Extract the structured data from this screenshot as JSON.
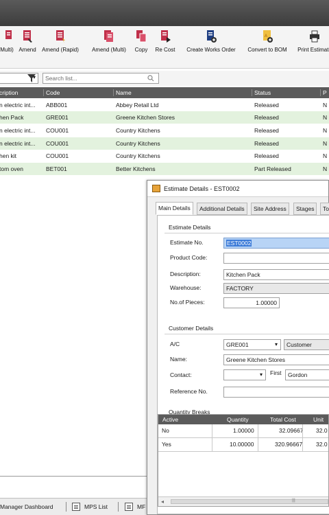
{
  "ribbon": {
    "items": [
      {
        "label": "Multi)",
        "icon": "amend-multi-icon"
      },
      {
        "label": "Amend",
        "icon": "amend-icon"
      },
      {
        "label": "Amend (Rapid)",
        "icon": "amend-rapid-icon"
      },
      {
        "label": "Amend (Multi)",
        "icon": "amend-multi-icon"
      },
      {
        "label": "Copy",
        "icon": "copy-icon"
      },
      {
        "label": "Re Cost",
        "icon": "recost-icon"
      },
      {
        "label": "Create Works Order",
        "icon": "create-works-order-icon"
      },
      {
        "label": "Convert to BOM",
        "icon": "convert-to-bom-icon"
      },
      {
        "label": "Print Estimate",
        "icon": "print-icon"
      }
    ],
    "icon_color": "#c0304a"
  },
  "filter": {
    "search_placeholder": "Search list..."
  },
  "grid": {
    "columns": [
      "cription",
      "Code",
      "Name",
      "Status",
      "P"
    ],
    "rows": [
      {
        "description": "n electric int...",
        "code": "ABB001",
        "name": "Abbey Retail Ltd",
        "status": "Released",
        "p": "N",
        "highlight": false
      },
      {
        "description": "hen Pack",
        "code": "GRE001",
        "name": "Greene Kitchen Stores",
        "status": "Released",
        "p": "N",
        "highlight": true
      },
      {
        "description": "n electric int...",
        "code": "COU001",
        "name": "Country Kitchens",
        "status": "Released",
        "p": "N",
        "highlight": false
      },
      {
        "description": "n electric int...",
        "code": "COU001",
        "name": "Country Kitchens",
        "status": "Released",
        "p": "N",
        "highlight": true
      },
      {
        "description": "hen kit",
        "code": "COU001",
        "name": "Country Kitchens",
        "status": "Released",
        "p": "N",
        "highlight": false
      },
      {
        "description": "tom oven",
        "code": "BET001",
        "name": "Better Kitchens",
        "status": "Part Released",
        "p": "N",
        "highlight": true
      }
    ],
    "highlight_color": "#e3f2de"
  },
  "taskbar": {
    "items": [
      "Manager Dashboard",
      "MPS List",
      "MF"
    ]
  },
  "dialog": {
    "title": "Estimate Details - EST0002",
    "tabs": [
      "Main Details",
      "Additional Details",
      "Site Address",
      "Stages",
      "To"
    ],
    "estimate_details": {
      "section": "Estimate Details",
      "estimate_no_label": "Estimate No.",
      "estimate_no": "EST0002",
      "product_code_label": "Product Code:",
      "product_code": "",
      "description_label": "Description:",
      "description": "Kitchen Pack",
      "warehouse_label": "Warehouse:",
      "warehouse": "FACTORY",
      "pieces_label": "No.of Pieces:",
      "pieces": "1.00000"
    },
    "customer_details": {
      "section": "Customer Details",
      "ac_label": "A/C",
      "ac": "GRE001",
      "ac_type": "Customer",
      "name_label": "Name:",
      "name": "Greene Kitchen Stores",
      "contact_label": "Contact:",
      "contact": "",
      "first_label": "First",
      "first": "Gordon",
      "reference_label": "Reference No.",
      "reference": ""
    },
    "quantity_breaks": {
      "section": "Quantity Breaks",
      "columns": [
        "Active",
        "Quantity",
        "Total Cost",
        "Unit"
      ],
      "rows": [
        {
          "active": "No",
          "quantity": "1.00000",
          "total_cost": "32.09667",
          "unit": "32.0"
        },
        {
          "active": "Yes",
          "quantity": "10.00000",
          "total_cost": "320.96667",
          "unit": "32.0"
        }
      ]
    }
  }
}
